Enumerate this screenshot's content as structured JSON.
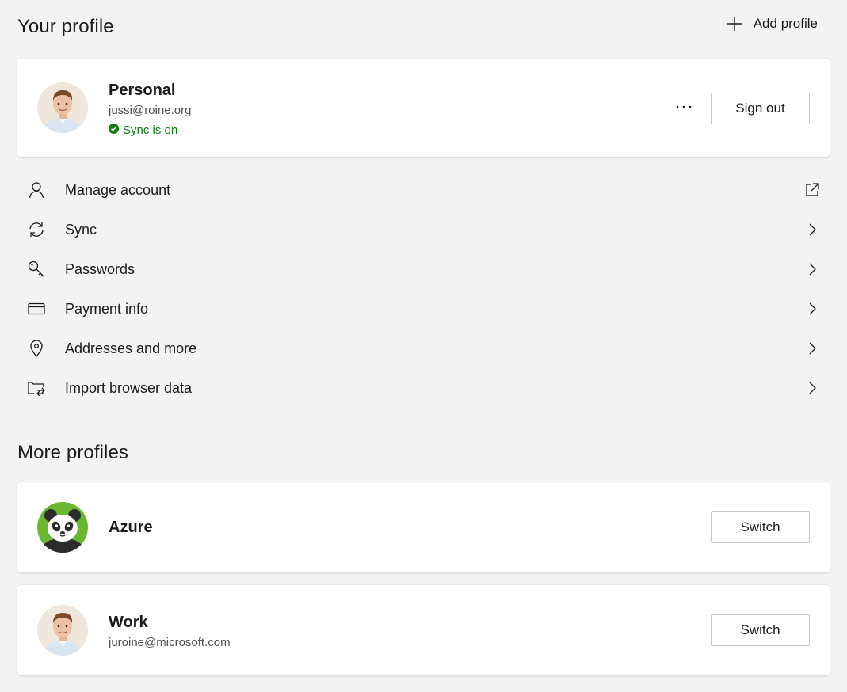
{
  "your_profile": {
    "title": "Your profile",
    "add_profile_label": "Add profile",
    "card": {
      "name": "Personal",
      "email": "jussi@roine.org",
      "sync_status": "Sync is on",
      "sign_out_label": "Sign out",
      "more_icon": "more-horizontal-icon"
    }
  },
  "menu": {
    "items": [
      {
        "label": "Manage account",
        "icon": "person-icon",
        "trail_icon": "open-external-icon"
      },
      {
        "label": "Sync",
        "icon": "sync-icon",
        "trail_icon": "chevron-right-icon"
      },
      {
        "label": "Passwords",
        "icon": "key-icon",
        "trail_icon": "chevron-right-icon"
      },
      {
        "label": "Payment info",
        "icon": "credit-card-icon",
        "trail_icon": "chevron-right-icon"
      },
      {
        "label": "Addresses and more",
        "icon": "location-pin-icon",
        "trail_icon": "chevron-right-icon"
      },
      {
        "label": "Import browser data",
        "icon": "import-icon",
        "trail_icon": "chevron-right-icon"
      }
    ]
  },
  "more_profiles": {
    "title": "More profiles",
    "profiles": [
      {
        "name": "Azure",
        "email": "",
        "switch_label": "Switch",
        "avatar": "panda-avatar"
      },
      {
        "name": "Work",
        "email": "juroine@microsoft.com",
        "switch_label": "Switch",
        "avatar": "person-photo-avatar"
      }
    ]
  },
  "colors": {
    "background": "#f3f3f3",
    "card": "#ffffff",
    "sync_green": "#107c10",
    "panda_green": "#6bb72f",
    "text": "#1b1b1b",
    "secondary_text": "#505050"
  }
}
